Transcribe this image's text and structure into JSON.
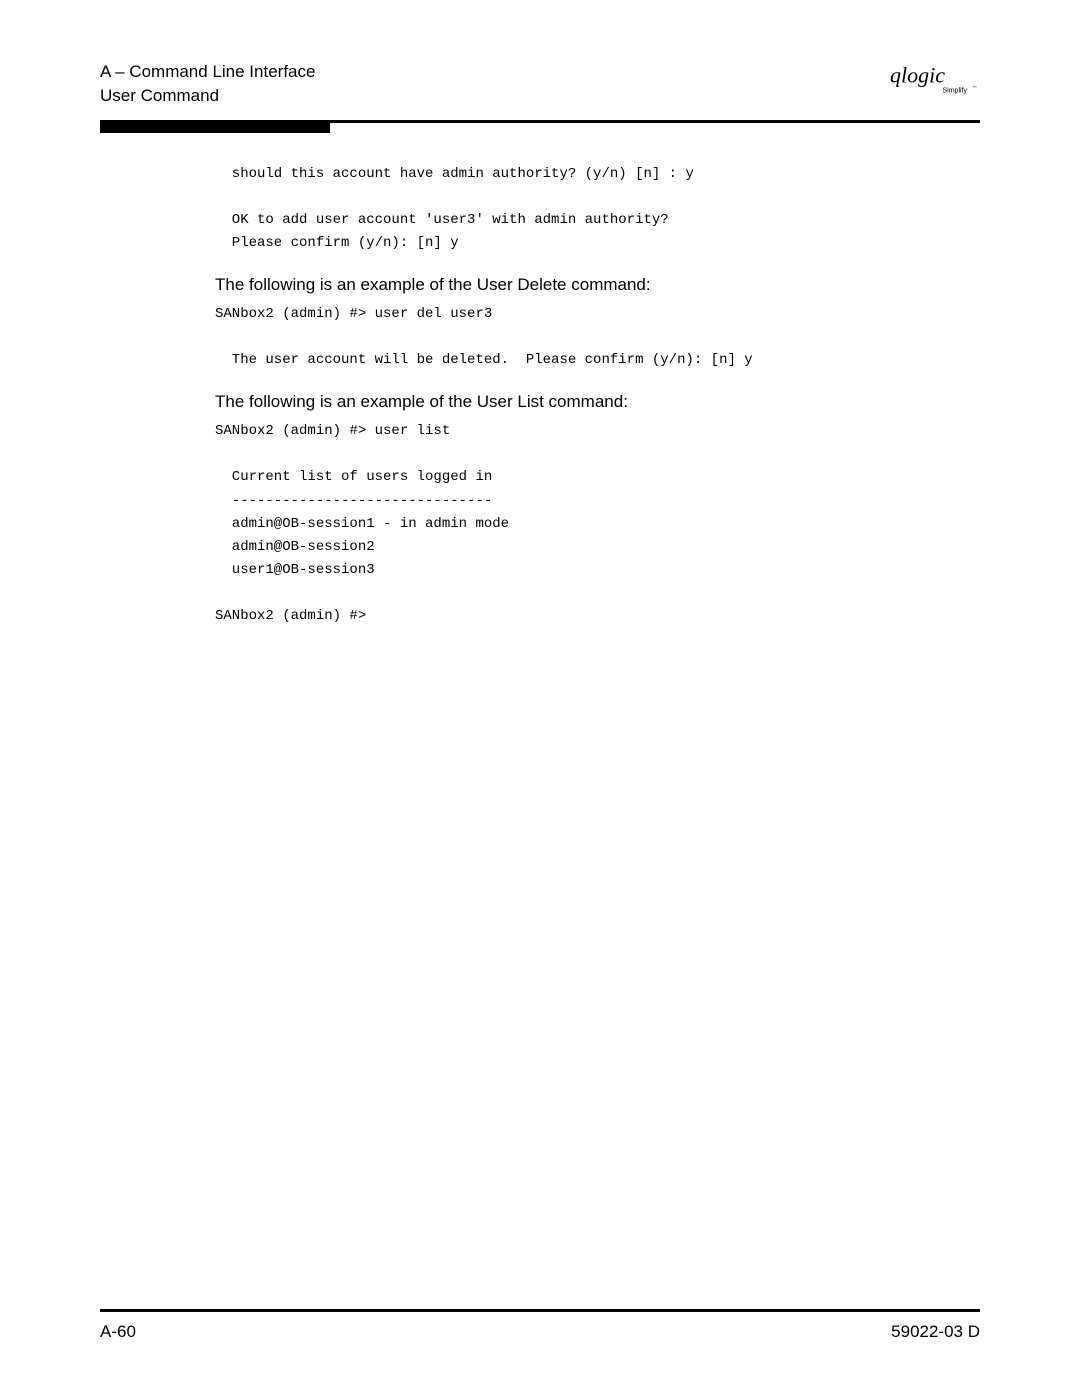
{
  "header": {
    "line1": "A – Command Line Interface",
    "line2": "User Command"
  },
  "logo": {
    "brand": "qlogic",
    "tag": "Simplify"
  },
  "blocks": {
    "pre1": "  should this account have admin authority? (y/n) [n] : y\n\n  OK to add user account 'user3' with admin authority?\n  Please confirm (y/n): [n] y",
    "para1": "The following is an example of the User Delete command:",
    "pre2": "SANbox2 (admin) #> user del user3\n\n  The user account will be deleted.  Please confirm (y/n): [n] y",
    "para2": "The following is an example of the User List command:",
    "pre3": "SANbox2 (admin) #> user list\n\n  Current list of users logged in\n  -------------------------------\n  admin@OB-session1 - in admin mode\n  admin@OB-session2\n  user1@OB-session3\n\nSANbox2 (admin) #>"
  },
  "footer": {
    "page": "A-60",
    "docid": "59022-03  D"
  }
}
